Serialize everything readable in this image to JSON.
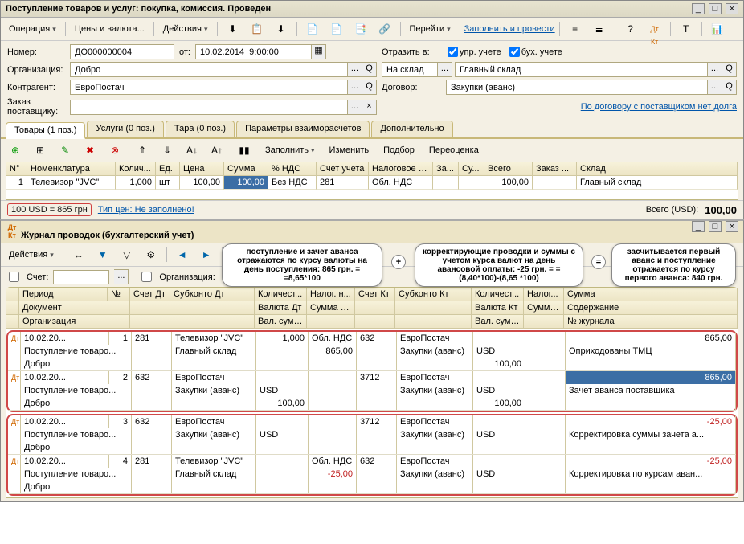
{
  "window": {
    "title": "Поступление товаров и услуг: покупка, комиссия. Проведен"
  },
  "toolbar1": {
    "operation": "Операция",
    "prices": "Цены и валюта...",
    "actions": "Действия",
    "goto": "Перейти",
    "fill_post": "Заполнить и провести"
  },
  "form": {
    "number_lbl": "Номер:",
    "number": "ДО000000004",
    "from_lbl": "от:",
    "date": "10.02.2014  9:00:00",
    "org_lbl": "Организация:",
    "org": "Добро",
    "contr_lbl": "Контрагент:",
    "contr": "ЕвроПостач",
    "order_lbl": "Заказ поставщику:",
    "reflect_lbl": "Отразить в:",
    "chk1": "упр. учете",
    "chk2": "бух. учете",
    "to_warehouse": "На склад",
    "warehouse": "Главный склад",
    "contract_lbl": "Договор:",
    "contract": "Закупки (аванс)",
    "debt_link": "По договору с поставщиком нет долга"
  },
  "tabs": {
    "t1": "Товары (1 поз.)",
    "t2": "Услуги (0 поз.)",
    "t3": "Тара (0 поз.)",
    "t4": "Параметры взаиморасчетов",
    "t5": "Дополнительно"
  },
  "subtb": {
    "fill": "Заполнить",
    "edit": "Изменить",
    "select": "Подбор",
    "reval": "Переоценка"
  },
  "grid1": {
    "headers": {
      "n": "N°",
      "nom": "Номенклатура",
      "qty": "Колич...",
      "unit": "Ед.",
      "price": "Цена",
      "sum": "Сумма",
      "vat": "% НДС",
      "acc": "Счет учета",
      "tax": "Налоговое н...",
      "za": "За...",
      "su": "Су...",
      "total": "Всего",
      "order": "Заказ ...",
      "wh": "Склад"
    },
    "row": {
      "n": "1",
      "nom": "Телевизор \"JVC\"",
      "qty": "1,000",
      "unit": "шт",
      "price": "100,00",
      "sum": "100,00",
      "vat": "Без НДС",
      "acc": "281",
      "tax": "Обл. НДС",
      "total": "100,00",
      "wh": "Главный склад"
    }
  },
  "footer1": {
    "rate": "100 USD = 865 грн",
    "tip": "Тип цен: Не заполнено!",
    "total_lbl": "Всего (USD):",
    "total": "100,00"
  },
  "journal": {
    "title": "Журнал проводок (бухгалтерский учет)",
    "actions": "Действия",
    "acc_lbl": "Счет:",
    "org_lbl": "Организация:"
  },
  "balloons": {
    "b1": "поступление и зачет аванса отражаются по курсу валюты на день поступления: 865 грн. = =8,65*100",
    "b2": "корректирующие проводки и суммы с учетом курса валют на день авансовой оплаты: -25 грн. = =(8,40*100)-(8,65 *100)",
    "b3": "засчитывается первый аванс и поступление отражается по курсу первого аванса: 840 грн."
  },
  "jhead": {
    "period": "Период",
    "n": "№",
    "accdt": "Счет Дт",
    "subdt": "Субконто Дт",
    "qty": "Количест...",
    "tax": "Налог. н...",
    "acckt": "Счет Кт",
    "subkt": "Субконто Кт",
    "qty2": "Количест...",
    "tax2": "Налог...",
    "sum": "Сумма",
    "doc": "Документ",
    "valdt": "Валюта Дт",
    "sumnu": "Сумма (н/у) Дт",
    "valkt": "Валюта Кт",
    "sumnu2": "Сумма (н/у) Кт",
    "content": "Содержание",
    "org": "Организация",
    "valsum": "Вал. сум....",
    "valsum2": "Вал. сумм...",
    "jn": "№ журнала"
  },
  "jrows": [
    {
      "p": "10.02.20...",
      "n": "1",
      "adt": "281",
      "sdt": "Телевизор \"JVC\"",
      "qty": "1,000",
      "tax": "Обл. НДС",
      "akt": "632",
      "skt": "ЕвроПостач",
      "sum": "865,00",
      "doc": "Поступление товаро...",
      "sdt2": "Главный склад",
      "qamt": "865,00",
      "skt2": "Закупки (аванс)",
      "valkt": "USD",
      "content": "Оприходованы ТМЦ",
      "org": "Добро",
      "vamt": "100,00"
    },
    {
      "p": "10.02.20...",
      "n": "2",
      "adt": "632",
      "sdt": "ЕвроПостач",
      "akt": "3712",
      "skt": "ЕвроПостач",
      "sum": "865,00",
      "sum_hl": true,
      "doc": "Поступление товаро...",
      "sdt2": "Закупки (аванс)",
      "valdt": "USD",
      "skt2": "Закупки (аванс)",
      "valkt": "USD",
      "content": "Зачет аванса поставщика",
      "org": "Добро",
      "vamtdt": "100,00",
      "vamt": "100,00"
    },
    {
      "p": "10.02.20...",
      "n": "3",
      "adt": "632",
      "sdt": "ЕвроПостач",
      "akt": "3712",
      "skt": "ЕвроПостач",
      "sum": "-25,00",
      "neg": true,
      "doc": "Поступление товаро...",
      "sdt2": "Закупки (аванс)",
      "valdt": "USD",
      "skt2": "Закупки (аванс)",
      "valkt": "USD",
      "content": "Корректировка суммы зачета а...",
      "org": "Добро"
    },
    {
      "p": "10.02.20...",
      "n": "4",
      "adt": "281",
      "sdt": "Телевизор \"JVC\"",
      "tax": "Обл. НДС",
      "akt": "632",
      "skt": "ЕвроПостач",
      "sum": "-25,00",
      "neg": true,
      "doc": "Поступление товаро...",
      "sdt2": "Главный склад",
      "qamt": "-25,00",
      "qneg": true,
      "skt2": "Закупки (аванс)",
      "valkt": "USD",
      "content": "Корректировка по курсам аван...",
      "org": "Добро"
    }
  ]
}
